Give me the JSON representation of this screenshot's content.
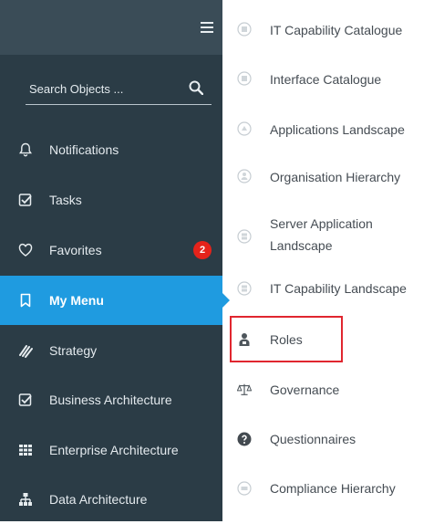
{
  "sidebar": {
    "search": {
      "placeholder": "Search Objects ..."
    },
    "items": [
      {
        "label": "Notifications"
      },
      {
        "label": "Tasks"
      },
      {
        "label": "Favorites",
        "badge": "2"
      },
      {
        "label": "My Menu",
        "active": true
      },
      {
        "label": "Strategy"
      },
      {
        "label": "Business Architecture"
      },
      {
        "label": "Enterprise Architecture"
      },
      {
        "label": "Data Architecture"
      }
    ],
    "colors": {
      "background": "#2b3c46",
      "active": "#1f9be0",
      "badge": "#e5231b"
    }
  },
  "submenu": {
    "items": [
      {
        "label": "IT Capability Catalogue",
        "icon": "circle-grid-icon"
      },
      {
        "label": "Interface Catalogue",
        "icon": "circle-grid-icon"
      },
      {
        "label": "Applications Landscape",
        "icon": "circle-apps-icon"
      },
      {
        "label": "Organisation Hierarchy",
        "icon": "circle-people-icon"
      },
      {
        "label": "Server Application Landscape",
        "icon": "circle-server-icon"
      },
      {
        "label": "IT Capability Landscape",
        "icon": "circle-server-icon"
      },
      {
        "label": "Roles",
        "icon": "roles-icon",
        "highlighted": true
      },
      {
        "label": "Governance",
        "icon": "scales-icon"
      },
      {
        "label": "Questionnaires",
        "icon": "question-circle-icon"
      },
      {
        "label": "Compliance Hierarchy",
        "icon": "circle-list-icon"
      }
    ],
    "highlight_color": "#e0262f"
  }
}
